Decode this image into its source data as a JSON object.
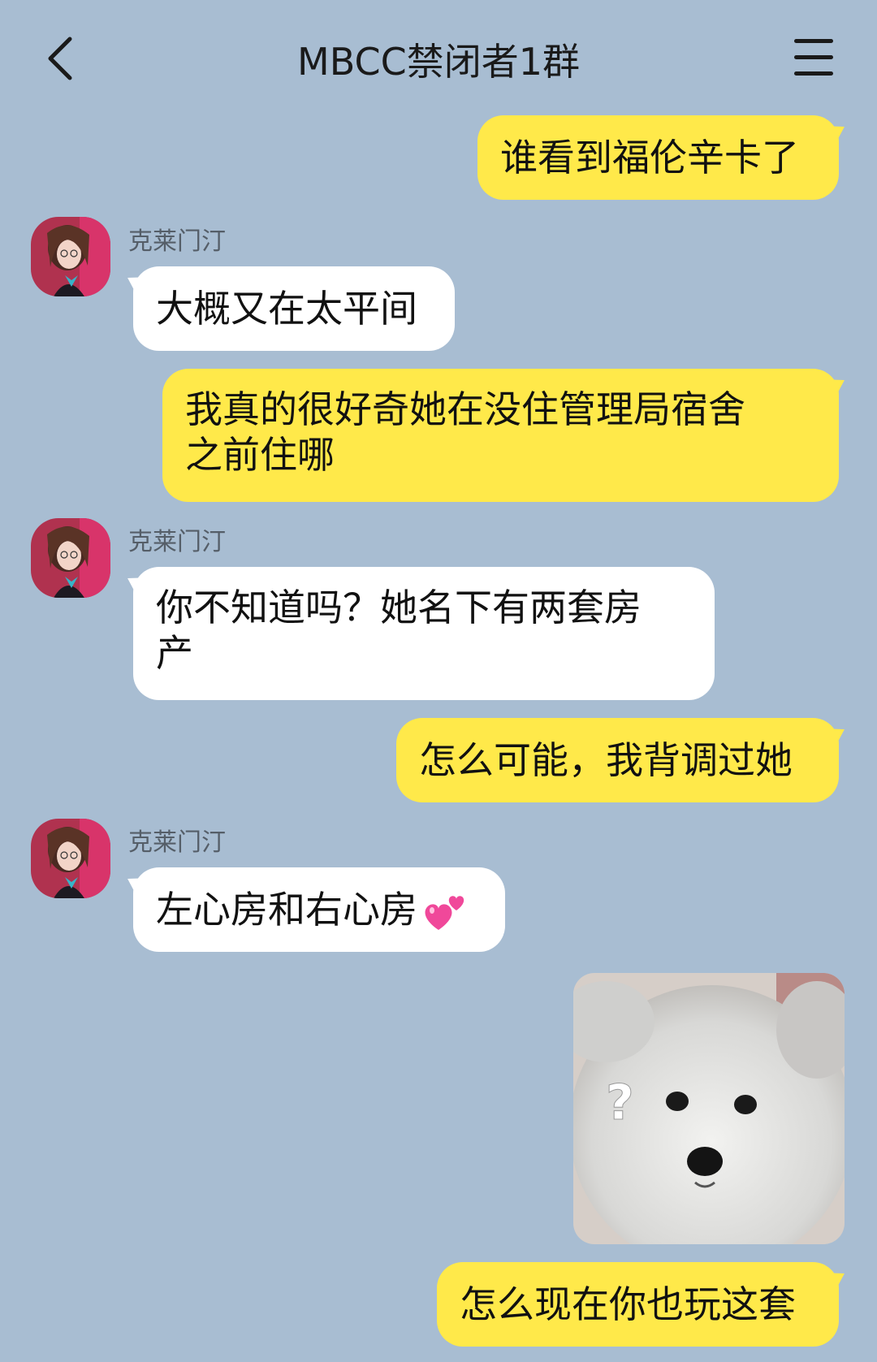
{
  "header": {
    "title": "MBCC禁闭者1群",
    "back_icon": "chevron-left-icon",
    "menu_icon": "hamburger-menu-icon"
  },
  "messages": [
    {
      "from": "me",
      "text": "谁看到福伦辛卡了"
    },
    {
      "from": "other",
      "sender": "克莱门汀",
      "text": "大概又在太平间"
    },
    {
      "from": "me",
      "text": "我真的很好奇她在没住管理局宿舍\n之前住哪"
    },
    {
      "from": "other",
      "sender": "克莱门汀",
      "text": "你不知道吗？她名下有两套房\n产"
    },
    {
      "from": "me",
      "text": "怎么可能，我背调过她"
    },
    {
      "from": "other",
      "sender": "克莱门汀",
      "text": "左心房和右心房",
      "emoji": "two-hearts-icon"
    },
    {
      "from": "me",
      "type": "image",
      "image": "confused-dog-sticker"
    },
    {
      "from": "me",
      "text": "怎么现在你也玩这套"
    }
  ],
  "colors": {
    "background": "#a8bdd2",
    "my_bubble": "#ffe94a",
    "other_bubble": "#ffffff"
  }
}
